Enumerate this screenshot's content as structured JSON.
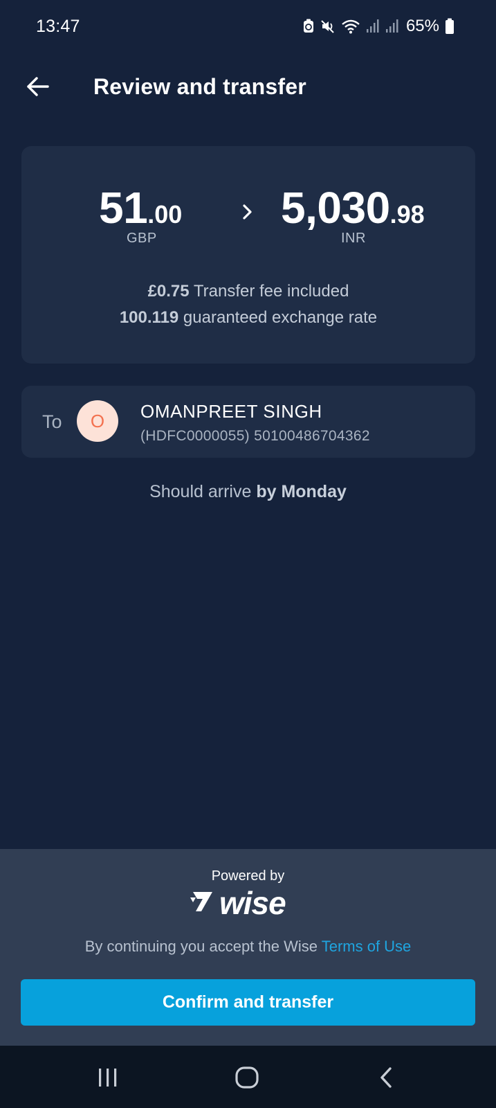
{
  "status_bar": {
    "time": "13:47",
    "battery": "65%",
    "icons": [
      "battery-saver-icon",
      "mute-icon",
      "wifi-icon",
      "signal-icon",
      "signal-icon",
      "battery-icon"
    ]
  },
  "header": {
    "back_icon": "arrow-left-icon",
    "title": "Review and transfer"
  },
  "amounts": {
    "send_whole": "51",
    "send_fraction": ".00",
    "send_currency": "GBP",
    "separator_icon": "chevron-right-icon",
    "receive_whole": "5,030",
    "receive_fraction": ".98",
    "receive_currency": "INR",
    "fee_value": "£0.75",
    "fee_text": " Transfer fee included",
    "rate_value": "100.119",
    "rate_text": " guaranteed exchange rate"
  },
  "recipient": {
    "to_label": "To",
    "avatar_initial": "O",
    "name": "OMANPREET SINGH",
    "account": "(HDFC0000055) 50100486704362"
  },
  "arrival": {
    "prefix": "Should arrive ",
    "day": "by Monday"
  },
  "footer": {
    "powered_by": "Powered by",
    "brand": "wise",
    "terms_prefix": "By continuing you accept the Wise ",
    "terms_link": "Terms of Use",
    "confirm_label": "Confirm and transfer"
  },
  "nav_bar": {
    "items": [
      "recents-icon",
      "home-icon",
      "back-icon"
    ]
  },
  "colors": {
    "background": "#15223b",
    "card": "#1f2d46",
    "panel": "#313e54",
    "accent": "#07a1dc",
    "link": "#1fa5e0",
    "avatar_bg": "#fde2d8",
    "avatar_fg": "#f3714f"
  }
}
